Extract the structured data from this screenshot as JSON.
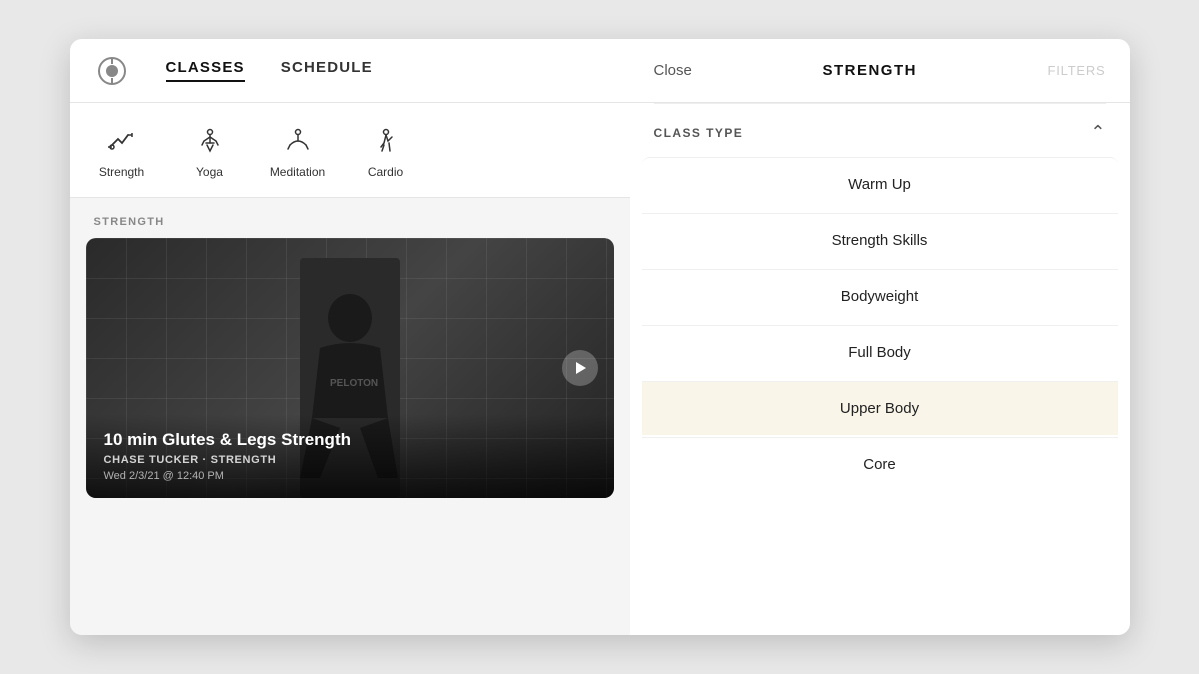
{
  "left": {
    "logo_label": "Peloton",
    "nav": {
      "classes_label": "CLASSES",
      "schedule_label": "SCHEDULE"
    },
    "categories": [
      {
        "id": "strength",
        "label": "Strength",
        "icon": "strength"
      },
      {
        "id": "yoga",
        "label": "Yoga",
        "icon": "yoga"
      },
      {
        "id": "meditation",
        "label": "Meditation",
        "icon": "meditation"
      },
      {
        "id": "cardio",
        "label": "Cardio",
        "icon": "cardio"
      }
    ],
    "section_label": "STRENGTH",
    "class_card": {
      "title": "10 min Glutes & Legs Strength",
      "subtitle": "CHASE TUCKER · STRENGTH",
      "date": "Wed 2/3/21 @ 12:40 PM"
    }
  },
  "right": {
    "close_label": "Close",
    "title": "STRENGTH",
    "filter_label": "FILTERS",
    "class_type_label": "CLASS TYPE",
    "items": [
      {
        "id": "warm-up",
        "label": "Warm Up",
        "highlighted": false
      },
      {
        "id": "strength-skills",
        "label": "Strength Skills",
        "highlighted": false
      },
      {
        "id": "bodyweight",
        "label": "Bodyweight",
        "highlighted": false
      },
      {
        "id": "full-body",
        "label": "Full Body",
        "highlighted": false
      },
      {
        "id": "upper-body",
        "label": "Upper Body",
        "highlighted": true
      },
      {
        "id": "core",
        "label": "Core",
        "highlighted": false
      }
    ]
  }
}
